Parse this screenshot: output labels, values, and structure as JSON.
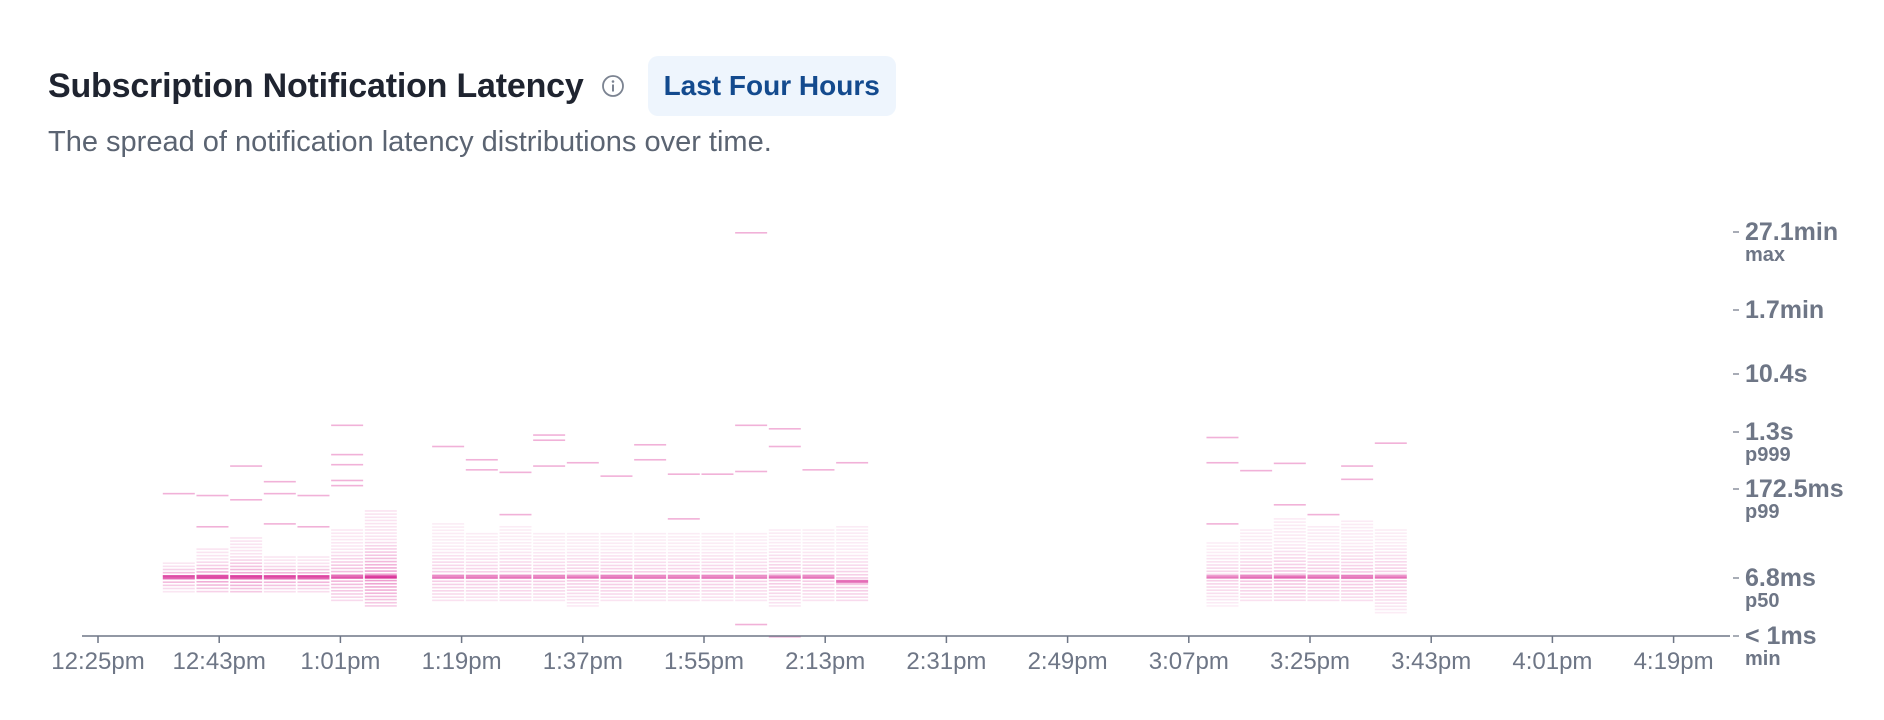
{
  "header": {
    "title": "Subscription Notification Latency",
    "info_icon": "info-circle-icon",
    "badge": "Last Four Hours",
    "subtitle": "The spread of notification latency distributions over time."
  },
  "colors": {
    "heat": "#d61f8f",
    "axis": "#6e7686",
    "badge_bg": "#eef5fd",
    "badge_text": "#134a8e"
  },
  "chart_data": {
    "type": "heatmap",
    "title": "Subscription Notification Latency",
    "x_ticks": [
      "12:25pm",
      "12:43pm",
      "1:01pm",
      "1:19pm",
      "1:37pm",
      "1:55pm",
      "2:13pm",
      "2:31pm",
      "2:49pm",
      "3:07pm",
      "3:25pm",
      "3:43pm",
      "4:01pm",
      "4:19pm"
    ],
    "y_ticks": [
      {
        "value": "27.1min",
        "label": "max"
      },
      {
        "value": "1.7min",
        "label": ""
      },
      {
        "value": "10.4s",
        "label": ""
      },
      {
        "value": "1.3s",
        "label": "p999"
      },
      {
        "value": "172.5ms",
        "label": "p99"
      },
      {
        "value": "6.8ms",
        "label": "p50"
      },
      {
        "value": "< 1ms",
        "label": "min"
      }
    ],
    "y_scale": "log",
    "x_range": [
      "12:25pm",
      "4:25pm"
    ],
    "columns": [
      {
        "time": "12:37pm",
        "min_ms": 4,
        "max_ms": 12,
        "p50_ms": 7,
        "intensity": 0.8,
        "extra_ms": [
          150
        ]
      },
      {
        "time": "12:42pm",
        "min_ms": 4,
        "max_ms": 20,
        "p50_ms": 7,
        "intensity": 0.9,
        "extra_ms": [
          45,
          140
        ]
      },
      {
        "time": "12:47pm",
        "min_ms": 4,
        "max_ms": 30,
        "p50_ms": 7,
        "intensity": 0.9,
        "extra_ms": [
          120,
          400
        ]
      },
      {
        "time": "12:52pm",
        "min_ms": 4,
        "max_ms": 15,
        "p50_ms": 7,
        "intensity": 0.85,
        "extra_ms": [
          50,
          150,
          230
        ]
      },
      {
        "time": "12:57pm",
        "min_ms": 4,
        "max_ms": 15,
        "p50_ms": 7,
        "intensity": 0.85,
        "extra_ms": [
          45,
          140
        ]
      },
      {
        "time": "1:02pm",
        "min_ms": 3,
        "max_ms": 40,
        "p50_ms": 7,
        "intensity": 0.7,
        "extra_ms": [
          200,
          240,
          420,
          600,
          1700
        ]
      },
      {
        "time": "1:07pm",
        "min_ms": 2.5,
        "max_ms": 80,
        "p50_ms": 7,
        "intensity": 0.95,
        "extra_ms": []
      },
      {
        "time": "1:17pm",
        "min_ms": 3,
        "max_ms": 50,
        "p50_ms": 7,
        "intensity": 0.45,
        "extra_ms": [
          800
        ]
      },
      {
        "time": "1:22pm",
        "min_ms": 3,
        "max_ms": 35,
        "p50_ms": 7,
        "intensity": 0.45,
        "extra_ms": [
          350,
          500
        ]
      },
      {
        "time": "1:27pm",
        "min_ms": 3,
        "max_ms": 45,
        "p50_ms": 7,
        "intensity": 0.45,
        "extra_ms": [
          70,
          320
        ]
      },
      {
        "time": "1:32pm",
        "min_ms": 3,
        "max_ms": 35,
        "p50_ms": 7,
        "intensity": 0.45,
        "extra_ms": [
          400,
          1000,
          1200
        ]
      },
      {
        "time": "1:37pm",
        "min_ms": 2.5,
        "max_ms": 35,
        "p50_ms": 7,
        "intensity": 0.45,
        "extra_ms": [
          450
        ]
      },
      {
        "time": "1:42pm",
        "min_ms": 3,
        "max_ms": 35,
        "p50_ms": 7,
        "intensity": 0.5,
        "extra_ms": [
          280
        ]
      },
      {
        "time": "1:47pm",
        "min_ms": 3,
        "max_ms": 35,
        "p50_ms": 7,
        "intensity": 0.45,
        "extra_ms": [
          500,
          850
        ]
      },
      {
        "time": "1:52pm",
        "min_ms": 3,
        "max_ms": 35,
        "p50_ms": 7,
        "intensity": 0.45,
        "extra_ms": [
          60,
          300
        ]
      },
      {
        "time": "1:57pm",
        "min_ms": 3,
        "max_ms": 35,
        "p50_ms": 7,
        "intensity": 0.45,
        "extra_ms": [
          300
        ]
      },
      {
        "time": "2:02pm",
        "min_ms": 3,
        "max_ms": 35,
        "p50_ms": 7,
        "intensity": 0.4,
        "extra_ms": [
          1.5,
          330,
          1700,
          2000000
        ]
      },
      {
        "time": "2:07pm",
        "min_ms": 2.5,
        "max_ms": 40,
        "p50_ms": 7,
        "intensity": 0.5,
        "extra_ms": [
          1,
          800,
          1500
        ]
      },
      {
        "time": "2:12pm",
        "min_ms": 3,
        "max_ms": 40,
        "p50_ms": 7,
        "intensity": 0.45,
        "extra_ms": [
          350
        ]
      },
      {
        "time": "2:17pm",
        "min_ms": 3,
        "max_ms": 45,
        "p50_ms": 6,
        "intensity": 0.5,
        "extra_ms": [
          450
        ]
      },
      {
        "time": "3:12pm",
        "min_ms": 2.5,
        "max_ms": 25,
        "p50_ms": 7,
        "intensity": 0.4,
        "extra_ms": [
          50,
          450,
          1100
        ]
      },
      {
        "time": "3:17pm",
        "min_ms": 3,
        "max_ms": 40,
        "p50_ms": 7,
        "intensity": 0.5,
        "extra_ms": [
          340
        ]
      },
      {
        "time": "3:22pm",
        "min_ms": 3,
        "max_ms": 60,
        "p50_ms": 7,
        "intensity": 0.55,
        "extra_ms": [
          100,
          440
        ]
      },
      {
        "time": "3:27pm",
        "min_ms": 3,
        "max_ms": 45,
        "p50_ms": 7,
        "intensity": 0.5,
        "extra_ms": [
          70
        ]
      },
      {
        "time": "3:32pm",
        "min_ms": 3,
        "max_ms": 55,
        "p50_ms": 7,
        "intensity": 0.5,
        "extra_ms": [
          250,
          400
        ]
      },
      {
        "time": "3:37pm",
        "min_ms": 2,
        "max_ms": 40,
        "p50_ms": 7,
        "intensity": 0.45,
        "extra_ms": [
          900
        ]
      }
    ]
  }
}
